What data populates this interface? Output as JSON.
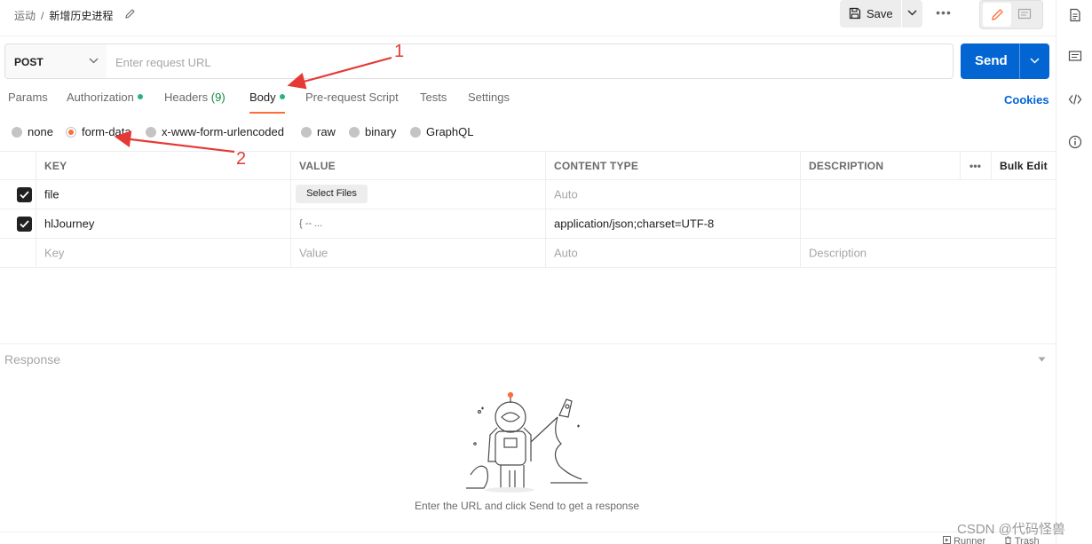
{
  "header": {
    "breadcrumb_parent": "运动",
    "breadcrumb_sep": "/",
    "title": "新增历史进程",
    "save_label": "Save",
    "more_label": "•••"
  },
  "request": {
    "method": "POST",
    "url_placeholder": "Enter request URL",
    "url_value": "",
    "send_label": "Send"
  },
  "tabs": [
    {
      "label": "Params"
    },
    {
      "label": "Authorization"
    },
    {
      "label": "Headers",
      "count": "(9)"
    },
    {
      "label": "Body"
    },
    {
      "label": "Pre-request Script"
    },
    {
      "label": "Tests"
    },
    {
      "label": "Settings"
    }
  ],
  "cookies_label": "Cookies",
  "body_types": [
    {
      "label": "none"
    },
    {
      "label": "form-data"
    },
    {
      "label": "x-www-form-urlencoded"
    },
    {
      "label": "raw"
    },
    {
      "label": "binary"
    },
    {
      "label": "GraphQL"
    }
  ],
  "selected_body_type": "form-data",
  "table": {
    "headers": {
      "key": "KEY",
      "value": "VALUE",
      "content_type": "CONTENT TYPE",
      "description": "DESCRIPTION",
      "more": "•••",
      "bulk_edit": "Bulk Edit"
    },
    "rows": [
      {
        "key": "file",
        "value_button": "Select Files",
        "content_type": "Auto",
        "checked": true
      },
      {
        "key": "hlJourney",
        "value": "{ -- ...",
        "content_type": "application/json;charset=UTF-8",
        "checked": true
      }
    ],
    "new_row": {
      "key": "Key",
      "value": "Value",
      "content_type": "Auto",
      "description": "Description"
    }
  },
  "response": {
    "title": "Response",
    "empty_message": "Enter the URL and click Send to get a response"
  },
  "footer": {
    "runner": "Runner",
    "trash": "Trash"
  },
  "annotations": {
    "label_1": "1",
    "label_2": "2",
    "color": "#e53935"
  },
  "watermark": "CSDN @代码怪兽",
  "colors": {
    "accent_orange": "#ff6c37",
    "send_blue": "#0265d2",
    "status_green": "#26b47f"
  }
}
